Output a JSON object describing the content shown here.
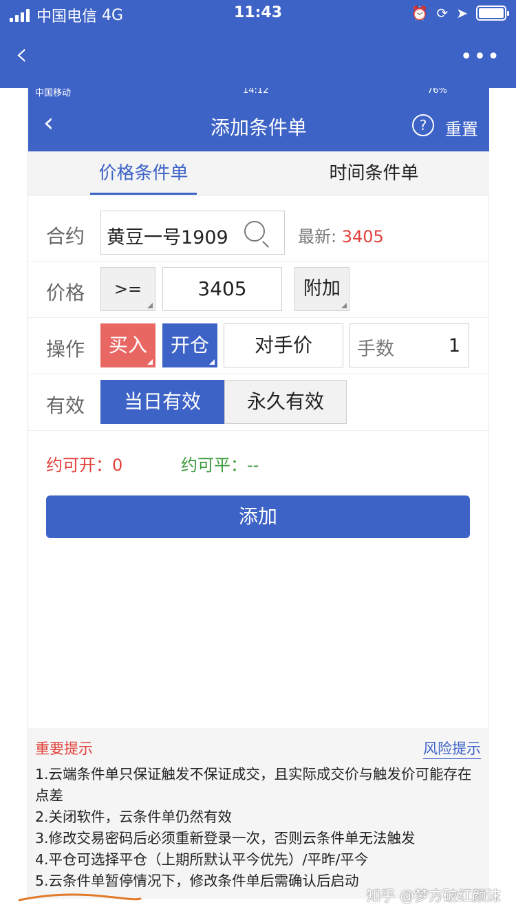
{
  "outer_status": {
    "carrier": "中国电信",
    "network": "4G",
    "time": "11:43"
  },
  "inner_status": {
    "carrier": "中国移动",
    "time": "14:12",
    "battery": "76%"
  },
  "inner_nav": {
    "title": "添加条件单",
    "help_glyph": "?",
    "reset_label": "重置"
  },
  "tabs": [
    {
      "label": "价格条件单",
      "active": true
    },
    {
      "label": "时间条件单",
      "active": false
    }
  ],
  "form": {
    "contract_label": "合约",
    "contract_value": "黄豆一号1909",
    "latest_label": "最新:",
    "latest_value": "3405",
    "price_label": "价格",
    "comparator": ">=",
    "price_value": "3405",
    "addon_label": "附加",
    "operation_label": "操作",
    "direction": "买入",
    "offset": "开仓",
    "price_type": "对手价",
    "quantity_label": "手数",
    "quantity_value": "1",
    "validity_label": "有效",
    "validity_today": "当日有效",
    "validity_forever": "永久有效"
  },
  "availability": {
    "open_label": "约可开：",
    "open_value": "0",
    "close_label": "约可平：",
    "close_value": "--"
  },
  "add_button": "添加",
  "notice": {
    "title": "重要提示",
    "risk_link": "风险提示",
    "items": [
      "1.云端条件单只保证触发不保证成交，且实际成交价与触发价可能存在点差",
      "2.关闭软件，云条件单仍然有效",
      "3.修改交易密码后必须重新登录一次，否则云条件单无法触发",
      "4.平仓可选择平仓（上期所默认平今优先）/平昨/平今",
      "5.云条件单暂停情况下，修改条件单后需确认后启动"
    ]
  },
  "watermark": "知乎 @梦方破红颜沫",
  "colors": {
    "brand_blue": "#3e63c7",
    "buy_red": "#e96763",
    "price_red": "#e2403a",
    "close_green": "#3a9a3a"
  }
}
